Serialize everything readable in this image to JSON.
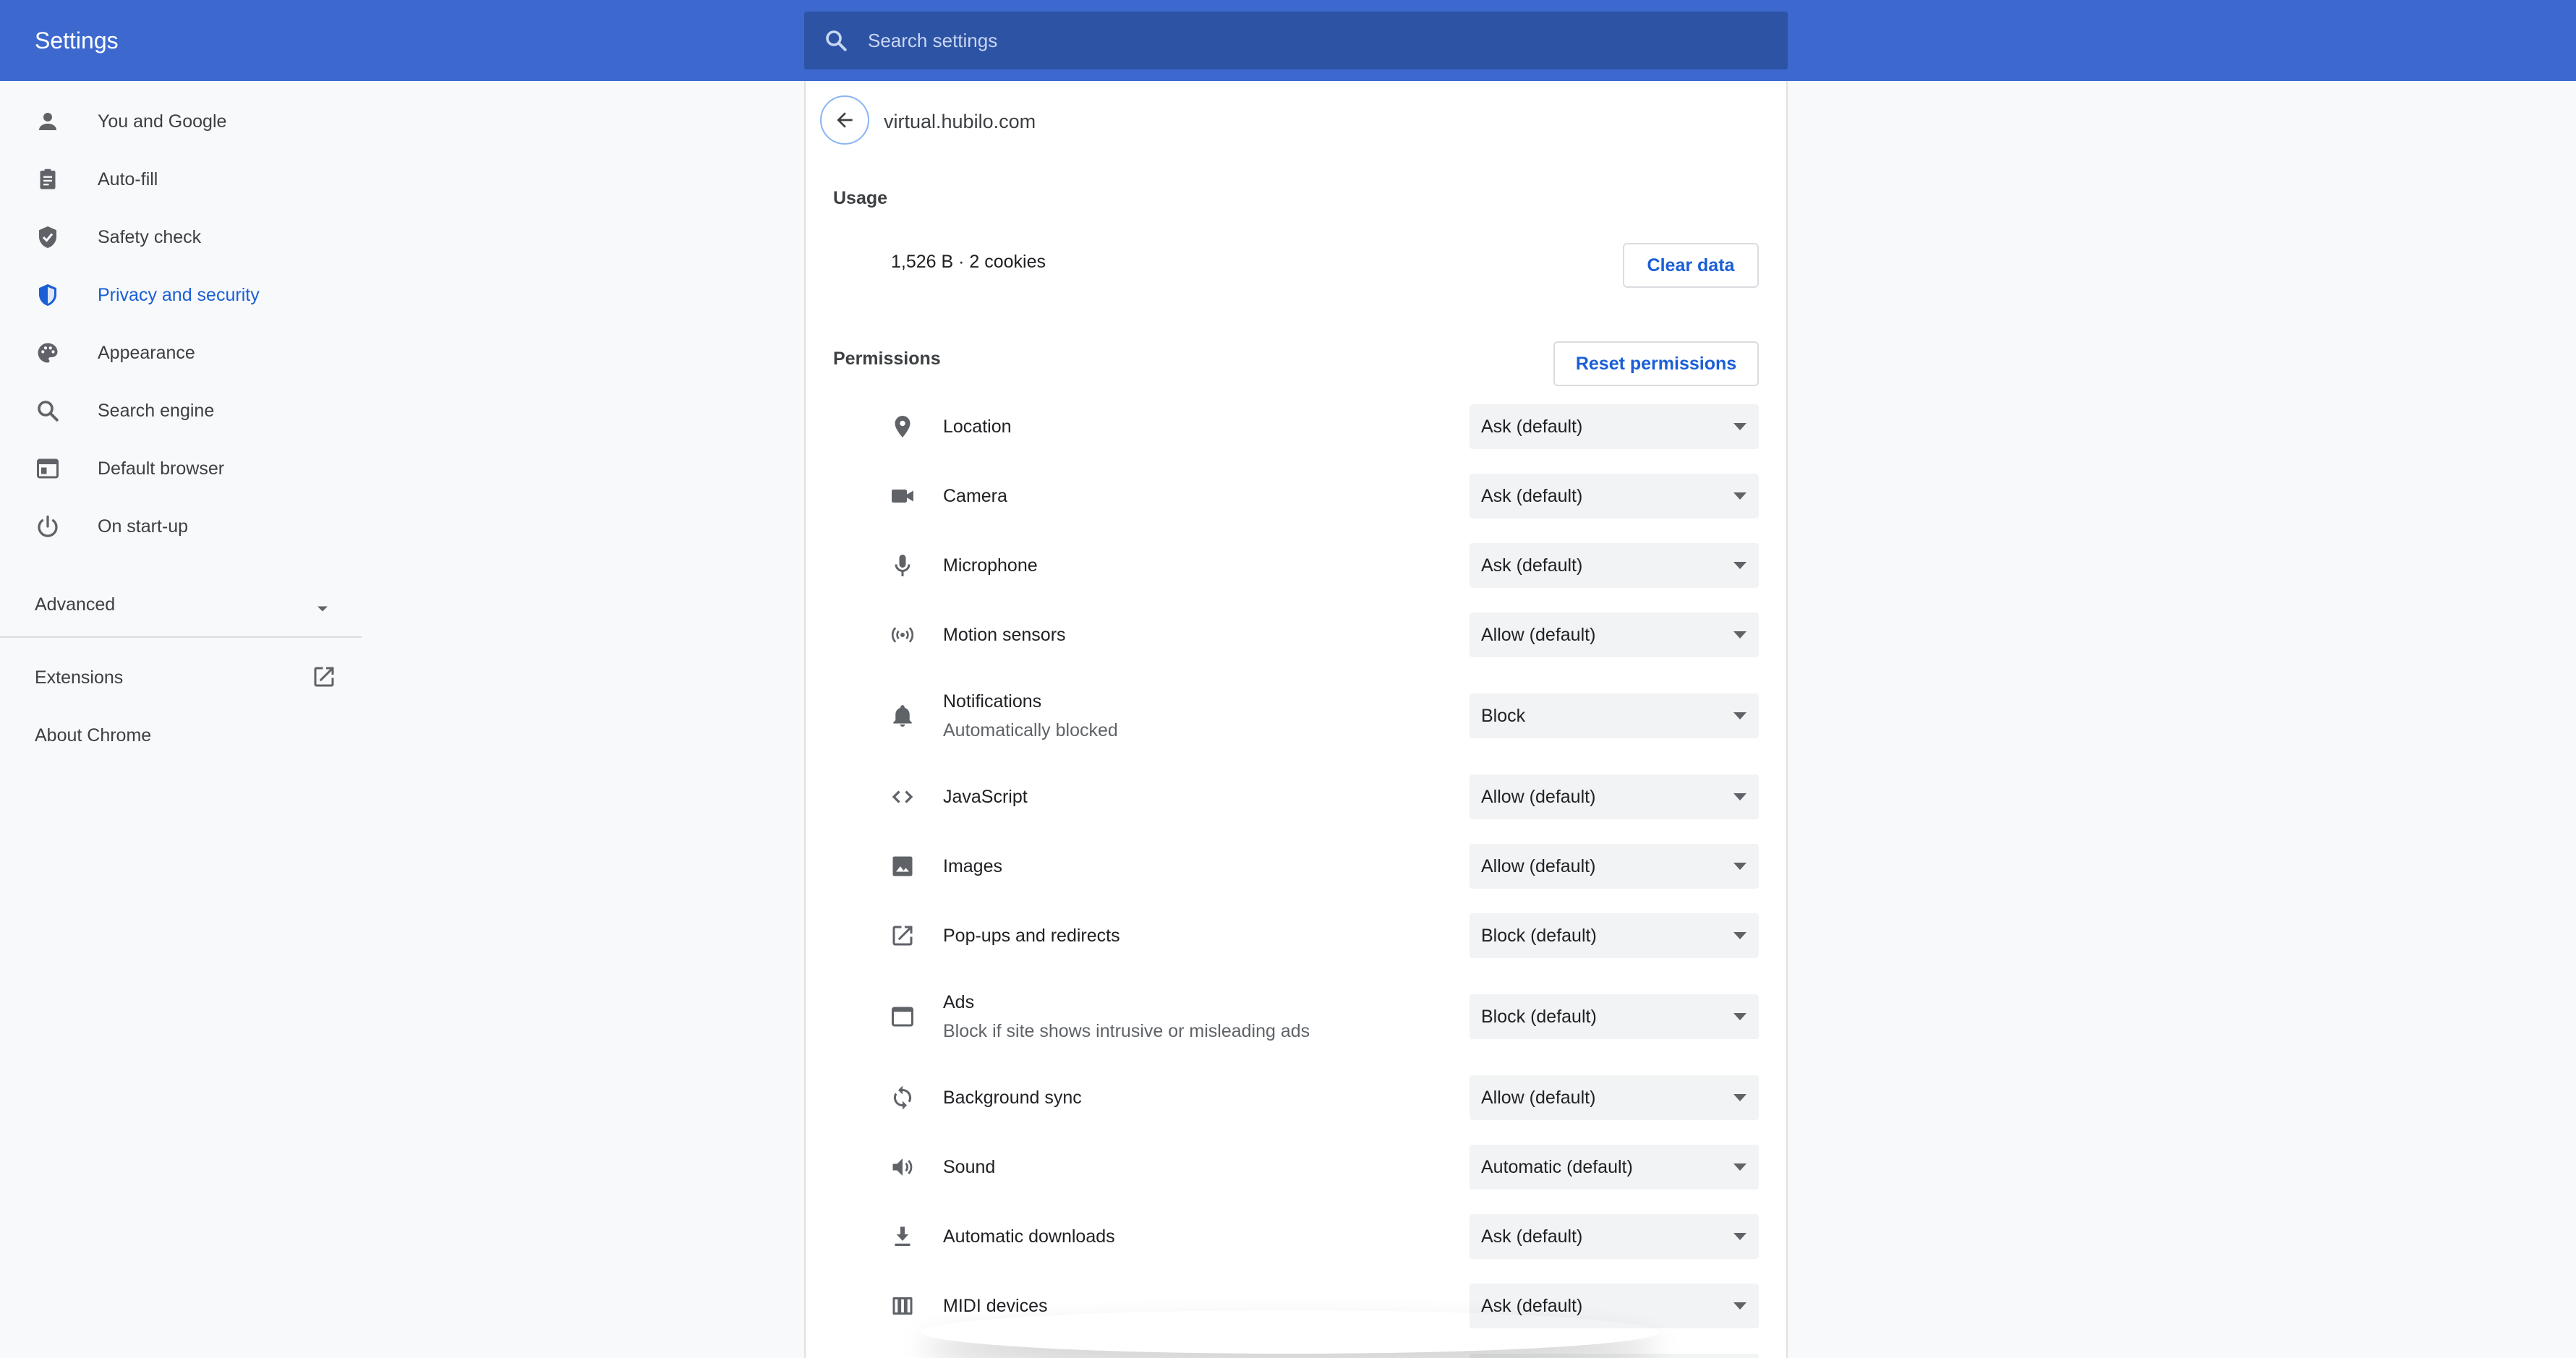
{
  "header": {
    "title": "Settings",
    "search_placeholder": "Search settings"
  },
  "sidebar": {
    "items": [
      {
        "label": "You and Google",
        "icon": "person-icon"
      },
      {
        "label": "Auto-fill",
        "icon": "clipboard-icon"
      },
      {
        "label": "Safety check",
        "icon": "shield-check-icon"
      },
      {
        "label": "Privacy and security",
        "icon": "shield-icon",
        "active": true
      },
      {
        "label": "Appearance",
        "icon": "palette-icon"
      },
      {
        "label": "Search engine",
        "icon": "search-icon"
      },
      {
        "label": "Default browser",
        "icon": "browser-icon"
      },
      {
        "label": "On start-up",
        "icon": "power-icon"
      }
    ],
    "advanced_label": "Advanced",
    "extensions_label": "Extensions",
    "about_label": "About Chrome"
  },
  "site": {
    "title": "virtual.hubilo.com"
  },
  "usage": {
    "section_label": "Usage",
    "summary": "1,526 B · 2 cookies",
    "clear_label": "Clear data"
  },
  "permissions": {
    "section_label": "Permissions",
    "reset_label": "Reset permissions",
    "items": [
      {
        "label": "Location",
        "sub": "",
        "value": "Ask (default)",
        "icon": "location-pin-icon"
      },
      {
        "label": "Camera",
        "sub": "",
        "value": "Ask (default)",
        "icon": "camera-icon"
      },
      {
        "label": "Microphone",
        "sub": "",
        "value": "Ask (default)",
        "icon": "microphone-icon"
      },
      {
        "label": "Motion sensors",
        "sub": "",
        "value": "Allow (default)",
        "icon": "motion-sensors-icon"
      },
      {
        "label": "Notifications",
        "sub": "Automatically blocked",
        "value": "Block",
        "icon": "bell-icon"
      },
      {
        "label": "JavaScript",
        "sub": "",
        "value": "Allow (default)",
        "icon": "code-icon"
      },
      {
        "label": "Images",
        "sub": "",
        "value": "Allow (default)",
        "icon": "image-icon"
      },
      {
        "label": "Pop-ups and redirects",
        "sub": "",
        "value": "Block (default)",
        "icon": "open-external-icon"
      },
      {
        "label": "Ads",
        "sub": "Block if site shows intrusive or misleading ads",
        "value": "Block (default)",
        "icon": "ads-window-icon"
      },
      {
        "label": "Background sync",
        "sub": "",
        "value": "Allow (default)",
        "icon": "sync-icon"
      },
      {
        "label": "Sound",
        "sub": "",
        "value": "Automatic (default)",
        "icon": "speaker-icon"
      },
      {
        "label": "Automatic downloads",
        "sub": "",
        "value": "Ask (default)",
        "icon": "download-icon"
      },
      {
        "label": "MIDI devices",
        "sub": "",
        "value": "Ask (default)",
        "icon": "piano-icon"
      }
    ]
  },
  "colors": {
    "header": "#3d69cf",
    "search_bg": "#2d53a5",
    "accent": "#1a5fd6",
    "icon": "#5f6368"
  }
}
